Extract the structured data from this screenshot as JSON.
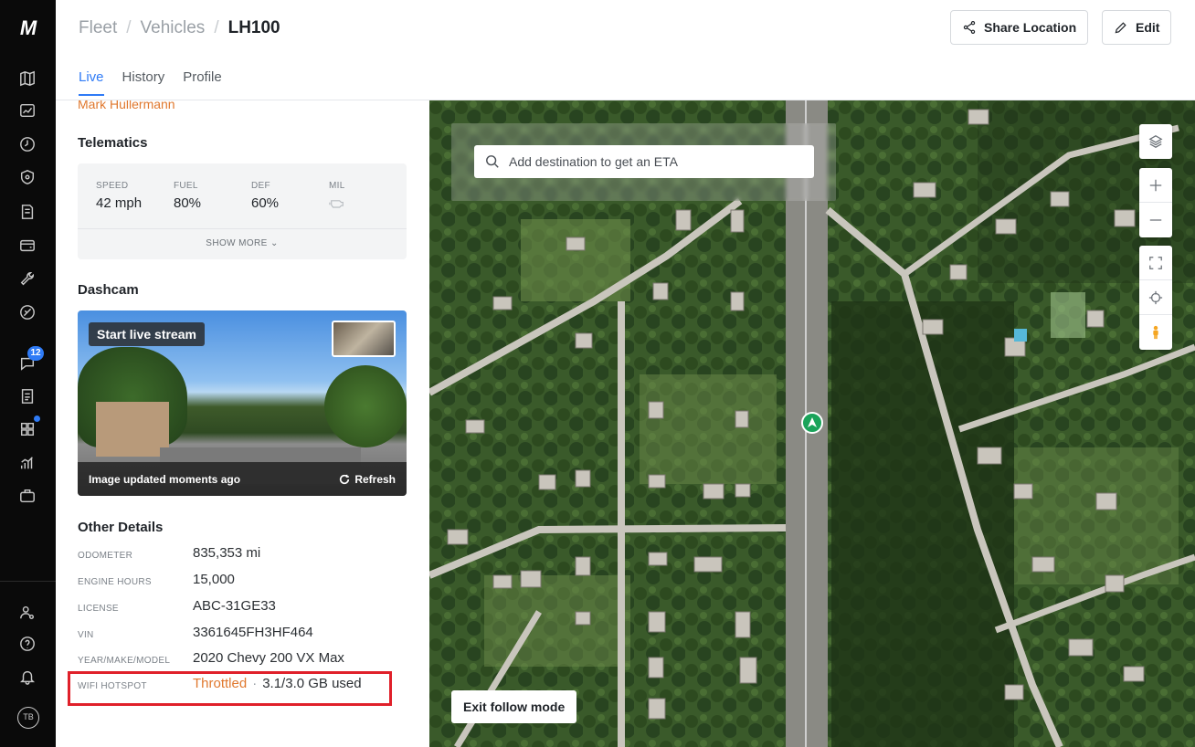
{
  "app": {
    "logo_text": "M"
  },
  "rail": {
    "icons": [
      "map-icon",
      "dashboard-icon",
      "clock-icon",
      "shield-icon",
      "document-icon",
      "wallet-icon",
      "wrench-icon",
      "tag-icon",
      "messages-icon",
      "report-icon",
      "apps-icon",
      "analytics-icon",
      "briefcase-icon"
    ],
    "messages_badge": "12",
    "bottom_icons": [
      "users-settings-icon",
      "help-icon",
      "bell-icon"
    ],
    "avatar_initials": "TB"
  },
  "header": {
    "breadcrumbs": [
      "Fleet",
      "Vehicles",
      "LH100"
    ],
    "share_label": "Share Location",
    "edit_label": "Edit",
    "tabs": [
      "Live",
      "History",
      "Profile"
    ]
  },
  "panel": {
    "driver_name": "Mark Hullermann",
    "telematics_title": "Telematics",
    "telematics": [
      {
        "label": "SPEED",
        "value": "42 mph"
      },
      {
        "label": "FUEL",
        "value": "80%"
      },
      {
        "label": "DEF",
        "value": "60%"
      },
      {
        "label": "MIL",
        "value": ""
      }
    ],
    "show_more": "SHOW MORE",
    "dashcam_title": "Dashcam",
    "live_stream": "Start live stream",
    "image_updated": "Image updated moments ago",
    "refresh": "Refresh",
    "details_title": "Other Details",
    "details": [
      {
        "label": "ODOMETER",
        "value": "835,353 mi"
      },
      {
        "label": "ENGINE HOURS",
        "value": "15,000"
      },
      {
        "label": "LICENSE",
        "value": "ABC-31GE33"
      },
      {
        "label": "VIN",
        "value": "3361645FH3HF464"
      },
      {
        "label": "YEAR/MAKE/MODEL",
        "value": "2020 Chevy 200 VX Max"
      }
    ],
    "wifi": {
      "label": "WIFI HOTSPOT",
      "status": "Throttled",
      "separator": "·",
      "usage": "3.1/3.0 GB used"
    }
  },
  "map": {
    "search_placeholder": "Add destination to get an ETA",
    "exit_follow": "Exit follow mode"
  }
}
